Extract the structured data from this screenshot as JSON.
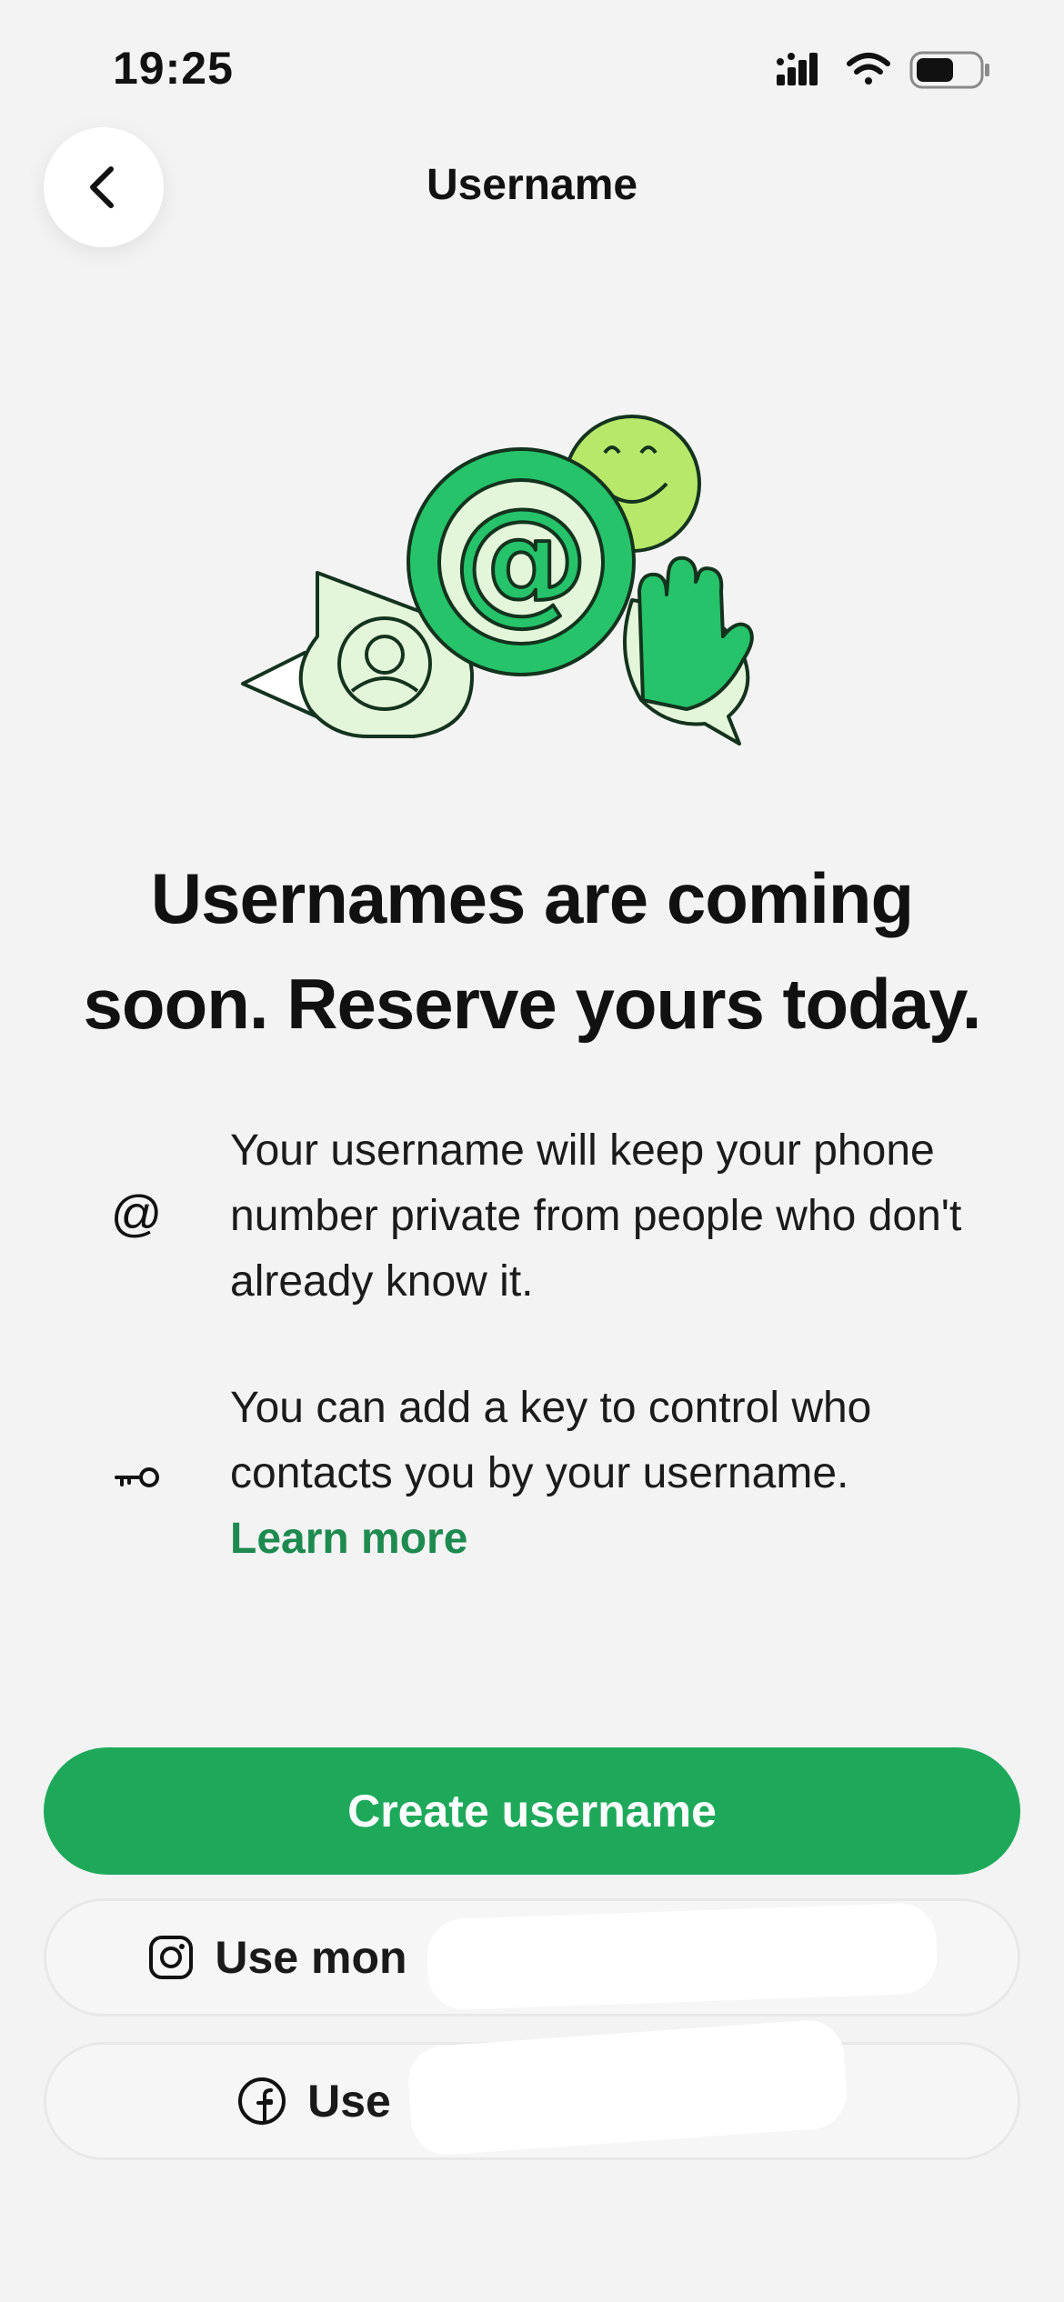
{
  "status": {
    "time": "19:25"
  },
  "nav": {
    "title": "Username",
    "back_icon": "chevron-left-icon"
  },
  "headline": "Usernames are coming soon. Reserve yours today.",
  "features": [
    {
      "icon": "at-icon",
      "text": "Your username will keep your phone number private from people who don't already know it."
    },
    {
      "icon": "key-icon",
      "text": "You can add a key to control who contacts you by your username.",
      "link": "Learn more"
    }
  ],
  "buttons": {
    "create": "Create username",
    "instagram_label": "Use mon",
    "facebook_label": "Use"
  },
  "colors": {
    "accent": "#1ea95a",
    "link": "#1d8a4f",
    "background": "#f3f3f3"
  }
}
